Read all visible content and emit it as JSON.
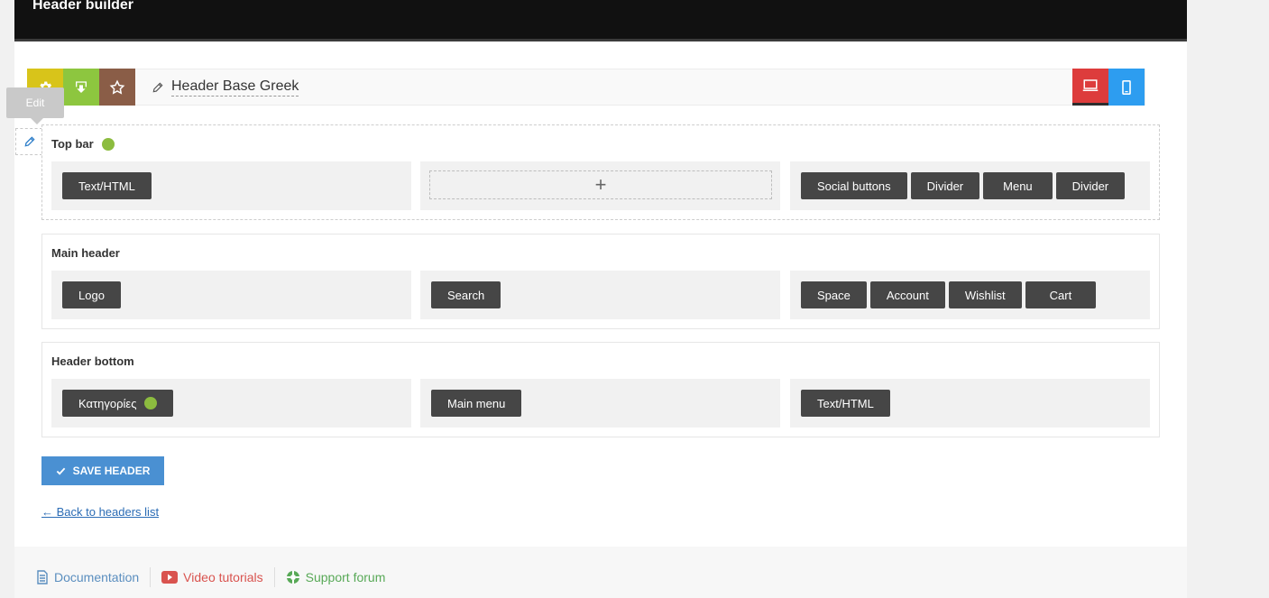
{
  "app": {
    "title": "Header builder"
  },
  "toolbar": {
    "header_name": "Header Base Greek"
  },
  "tooltip": {
    "text": "Edit"
  },
  "rows": [
    {
      "title": "Top bar",
      "left": [
        "Text/HTML"
      ],
      "center_add": "+",
      "right": [
        "Social buttons",
        "Divider",
        "Menu",
        "Divider"
      ]
    },
    {
      "title": "Main header",
      "left": [
        "Logo"
      ],
      "center": [
        "Search"
      ],
      "right": [
        "Space",
        "Account",
        "Wishlist",
        "Cart"
      ]
    },
    {
      "title": "Header bottom",
      "left": [
        "Κατηγορίες"
      ],
      "center": [
        "Main menu"
      ],
      "right": [
        "Text/HTML"
      ]
    }
  ],
  "actions": {
    "save_label": "SAVE HEADER",
    "back_label": "← Back to headers list"
  },
  "footer": {
    "documentation": "Documentation",
    "video": "Video tutorials",
    "support": "Support forum"
  },
  "colors": {
    "settings": "#d8c41a",
    "import": "#8dc63f",
    "star": "#8a5d47",
    "desktop": "#dd3c3c",
    "mobile": "#2d9df0",
    "chip": "#464646",
    "save": "#4a90d2"
  }
}
